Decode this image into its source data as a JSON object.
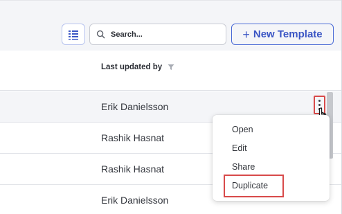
{
  "toolbar": {
    "search": {
      "placeholder": "Search...",
      "value": ""
    },
    "new_template_label": "New Template",
    "new_template_icon": "plus-icon",
    "view_toggle_icon": "list-view-icon"
  },
  "table": {
    "columns": [
      {
        "label": "Last updated by",
        "icon": "filter-icon"
      }
    ],
    "rows": [
      {
        "last_updated_by": "Erik Danielsson"
      },
      {
        "last_updated_by": "Rashik Hasnat"
      },
      {
        "last_updated_by": "Rashik Hasnat"
      },
      {
        "last_updated_by": "Erik Danielsson"
      }
    ]
  },
  "context_menu": {
    "items": [
      {
        "label": "Open"
      },
      {
        "label": "Edit"
      },
      {
        "label": "Share"
      },
      {
        "label": "Duplicate"
      }
    ],
    "highlighted": "Duplicate"
  },
  "colors": {
    "accent": "#3a55c4",
    "highlight": "#d84a4a",
    "toolbar_bg": "#f4f5f8"
  }
}
